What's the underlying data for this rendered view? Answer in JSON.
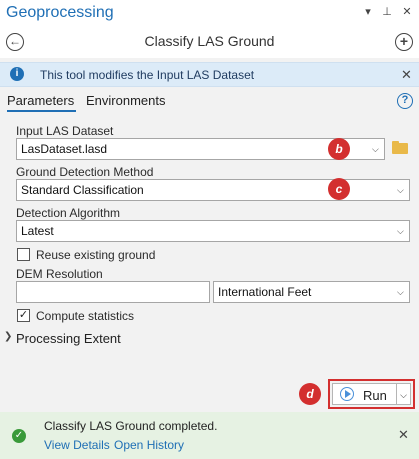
{
  "pane": {
    "title": "Geoprocessing",
    "menu_icon": "▾",
    "pin_icon": "⊥",
    "close_icon": "✕"
  },
  "tool": {
    "name": "Classify LAS Ground",
    "back_icon": "←",
    "add_icon": "+"
  },
  "info": {
    "message": "This tool modifies the Input LAS Dataset",
    "icon": "i",
    "close_icon": "✕"
  },
  "tabs": [
    {
      "label": "Parameters",
      "active": true
    },
    {
      "label": "Environments",
      "active": false
    }
  ],
  "help_icon": "?",
  "params": {
    "input_las": {
      "label": "Input LAS Dataset",
      "value": "LasDataset.lasd"
    },
    "ground_method": {
      "label": "Ground Detection Method",
      "value": "Standard Classification"
    },
    "algorithm": {
      "label": "Detection Algorithm",
      "value": "Latest"
    },
    "reuse_ground": {
      "label": "Reuse existing ground",
      "checked": false
    },
    "dem_resolution": {
      "label": "DEM Resolution",
      "value": "",
      "unit": "International Feet"
    },
    "compute_stats": {
      "label": "Compute statistics",
      "checked": true
    },
    "processing_extent": {
      "label": "Processing Extent"
    }
  },
  "badges": {
    "b": "b",
    "c": "c",
    "d": "d"
  },
  "run": {
    "label": "Run"
  },
  "status": {
    "message": "Classify LAS Ground completed.",
    "view_details": "View Details",
    "open_history": "Open History",
    "close_icon": "✕"
  },
  "colors": {
    "accent": "#1f6fb5",
    "badge_red": "#d32f2f",
    "info_bg": "#dcebf8",
    "success_bg": "#e6f2e3"
  }
}
